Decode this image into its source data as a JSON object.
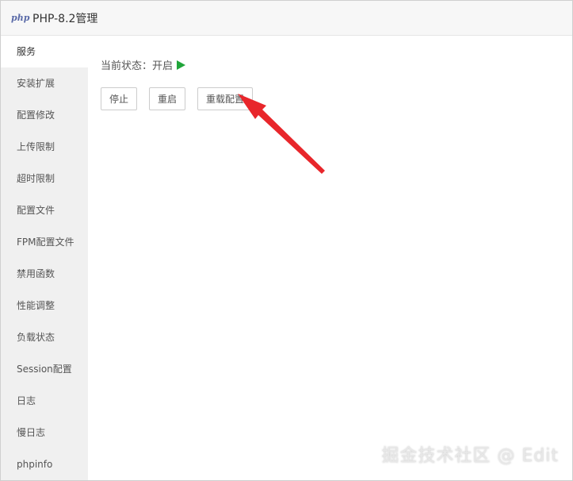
{
  "window": {
    "logo_text": "php",
    "title": "PHP-8.2管理"
  },
  "sidebar": {
    "items": [
      {
        "label": "服务",
        "active": true
      },
      {
        "label": "安装扩展"
      },
      {
        "label": "配置修改"
      },
      {
        "label": "上传限制"
      },
      {
        "label": "超时限制"
      },
      {
        "label": "配置文件"
      },
      {
        "label": "FPM配置文件"
      },
      {
        "label": "禁用函数"
      },
      {
        "label": "性能调整"
      },
      {
        "label": "负载状态"
      },
      {
        "label": "Session配置"
      },
      {
        "label": "日志"
      },
      {
        "label": "慢日志"
      },
      {
        "label": "phpinfo"
      }
    ]
  },
  "service": {
    "status_label": "当前状态：",
    "status_value": "开启",
    "status_color": "#20a53a",
    "buttons": {
      "stop": "停止",
      "restart": "重启",
      "reload": "重载配置"
    }
  },
  "watermark": "掘金技术社区 @ Edit",
  "annotation": {
    "arrow_color": "#e8262b"
  }
}
